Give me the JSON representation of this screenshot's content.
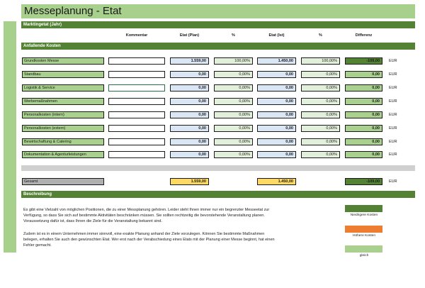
{
  "title": "Messeplanung - Etat",
  "section_marktingetat": "Marktingetat (Jahr)",
  "columns": {
    "kommentar": "Kommentar",
    "etat_plan": "Etat (Plan)",
    "pct1": "%",
    "etat_ist": "Etat (Ist)",
    "pct2": "%",
    "differenz": "Differenz"
  },
  "section_kosten": "Anfallende Kosten",
  "rows": [
    {
      "label": "Grundkosten Messe",
      "plan": "1.559,00",
      "plan_pct": "100,00%",
      "ist": "1.450,00",
      "ist_pct": "100,00%",
      "diff": "-109,00",
      "unit": "EUR"
    },
    {
      "label": "Standbau",
      "plan": "0,00",
      "plan_pct": "0,00%",
      "ist": "0,00",
      "ist_pct": "0,00%",
      "diff": "0,00",
      "unit": "EUR"
    },
    {
      "label": "Logistik & Service",
      "plan": "0,00",
      "plan_pct": "0,00%",
      "ist": "0,00",
      "ist_pct": "0,00%",
      "diff": "0,00",
      "unit": "EUR"
    },
    {
      "label": "Werbemaßnahmen",
      "plan": "0,00",
      "plan_pct": "0,00%",
      "ist": "0,00",
      "ist_pct": "0,00%",
      "diff": "0,00",
      "unit": "EUR"
    },
    {
      "label": "Personalkosten (intern)",
      "plan": "0,00",
      "plan_pct": "0,00%",
      "ist": "0,00",
      "ist_pct": "0,00%",
      "diff": "0,00",
      "unit": "EUR"
    },
    {
      "label": "Personalkosten (extern)",
      "plan": "0,00",
      "plan_pct": "0,00%",
      "ist": "0,00",
      "ist_pct": "0,00%",
      "diff": "0,00",
      "unit": "EUR"
    },
    {
      "label": "Bewirtschaftung & Catering",
      "plan": "0,00",
      "plan_pct": "0,00%",
      "ist": "0,00",
      "ist_pct": "0,00%",
      "diff": "0,00",
      "unit": "EUR"
    },
    {
      "label": "Dokumentation & Agenturleistungen",
      "plan": "0,00",
      "plan_pct": "0,00%",
      "ist": "0,00",
      "ist_pct": "0,00%",
      "diff": "0,00",
      "unit": "EUR"
    }
  ],
  "total": {
    "label": "Gesamt",
    "plan": "1.559,00",
    "ist": "1.450,00",
    "diff": "-109,00",
    "unit": "EUR"
  },
  "section_beschreibung": "Beschreibung",
  "description": [
    "Es gibt eine Vielzahl von möglichen Positionen, die zu einer Messplanung gehören. Leider steht Ihnen immer nur ein begrenzter Messeetat zur",
    "Verfügung, so dass Sie sich auf bestimmte Aktivitäten beschränken müssen. Sie sollten rechtzeitig die bevorstehende Veranstaltung planen.",
    "Voraussetzung dafür ist, dass Ihnen die Ziele für die Veranstaltung bekannt sind.",
    "Zudem ist es in einem Unternehmen immer sinnvoll, eine exakte Planung anhand der Ziele vorzulegen. Können Sie bestimmte Maßnahmen",
    "belegen, erhalten Sie auch den gewünschten Etat. Wer erst nach der Verabschiedung eines Etats mit der Planung einer Messe beginnt, hat einen",
    "Fehler gemacht."
  ],
  "legend": [
    {
      "label": "Niedrigere Kosten",
      "color": "#548235"
    },
    {
      "label": "Höhere Kosten",
      "color": "#ed7d31"
    },
    {
      "label": "gleich",
      "color": "#a9d08e"
    }
  ]
}
